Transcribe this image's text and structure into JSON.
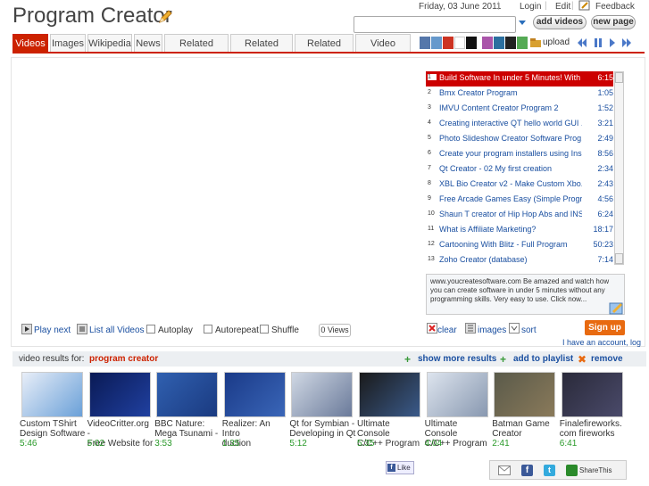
{
  "header": {
    "title": "Program Creator",
    "date": "Friday, 03 June 2011",
    "login": "Login",
    "edit": "Edit",
    "feedback": "Feedback",
    "search_value": "",
    "add_videos": "add videos",
    "new_page": "new page"
  },
  "tabs": [
    {
      "label": "Videos",
      "active": true
    },
    {
      "label": "Images"
    },
    {
      "label": "Wikipedia"
    },
    {
      "label": "News"
    },
    {
      "label": "Related People"
    },
    {
      "label": "Related Places"
    },
    {
      "label": "Related Sites"
    },
    {
      "label": "Video Details"
    }
  ],
  "toolbar": {
    "upload": "upload",
    "swatch_colors": [
      "#5577aa",
      "#6699cc",
      "#cc3322",
      "#ffffff",
      "#111111",
      "#aa55aa",
      "#2b6f9f",
      "#222222",
      "#55aa55"
    ],
    "accent": "#cc2200"
  },
  "playlist": [
    {
      "n": "1",
      "title": "Build Software In under 5 Minutes! With ...",
      "dur": "6:15"
    },
    {
      "n": "2",
      "title": "Bmx Creator Program",
      "dur": "1:05"
    },
    {
      "n": "3",
      "title": "IMVU Content Creator Program 2",
      "dur": "1:52"
    },
    {
      "n": "4",
      "title": "Creating interactive QT hello world GUI ...",
      "dur": "3:21"
    },
    {
      "n": "5",
      "title": "Photo Slideshow Creator Software Prog...",
      "dur": "2:49"
    },
    {
      "n": "6",
      "title": "Create your program installers using Ins...",
      "dur": "8:56"
    },
    {
      "n": "7",
      "title": "Qt Creator - 02 My first creation",
      "dur": "2:34"
    },
    {
      "n": "8",
      "title": "XBL Bio Creator v2 - Make Custom Xbo...",
      "dur": "2:43"
    },
    {
      "n": "9",
      "title": "Free Arcade Games Easy (Simple Progr...",
      "dur": "4:56"
    },
    {
      "n": "10",
      "title": "Shaun T creator of Hip Hop Abs and INS...",
      "dur": "6:24"
    },
    {
      "n": "11",
      "title": "What is Affiliate Marketing?",
      "dur": "18:17"
    },
    {
      "n": "12",
      "title": "Cartooning With Blitz - Full Program",
      "dur": "50:23"
    },
    {
      "n": "13",
      "title": "Zoho Creator (database)",
      "dur": "7:14"
    }
  ],
  "description": "www.youcreatesoftware.com Be amazed and watch how you can create software in under 5 minutes without any programming skills. Very easy to use. Click now...",
  "controls": {
    "play_next": "Play next",
    "list_all": "List all Videos",
    "autoplay": "Autoplay",
    "autorepeat": "Autorepeat",
    "shuffle": "Shuffle",
    "views": "0 Views",
    "clear": "clear",
    "images": "images",
    "sort": "sort",
    "sign_up": "Sign up",
    "have_account": "I have an account, log"
  },
  "results": {
    "label": "video results for:",
    "query": "program creator",
    "show_more": "show more results",
    "add_playlist": "add to playlist",
    "remove": "remove"
  },
  "thumbs": [
    {
      "l1": "Custom TShirt",
      "l2": "Design Software",
      "dur": "5:46"
    },
    {
      "l1": "VideoCritter.org -",
      "l2": "Free Website for",
      "dur": "5:02"
    },
    {
      "l1": "BBC Nature:",
      "l2": "Mega Tsunami -",
      "dur": "3:53"
    },
    {
      "l1": "Realizer: An Intro",
      "l2": "duction",
      "dur": "1:35"
    },
    {
      "l1": "Qt for Symbian -",
      "l2": "Developing in Qt",
      "dur": "5:12"
    },
    {
      "l1": "Ultimate Console",
      "l2": "C/C++ Program",
      "dur": "5:35"
    },
    {
      "l1": "Ultimate Console",
      "l2": "C/C++ Program",
      "dur": "4:04"
    },
    {
      "l1": "Batman Game",
      "l2": "Creator",
      "dur": "2:41"
    },
    {
      "l1": "Finalefireworks.",
      "l2": "com fireworks",
      "dur": "6:41"
    }
  ],
  "footer": {
    "like": "Like",
    "share": "ShareThis"
  }
}
